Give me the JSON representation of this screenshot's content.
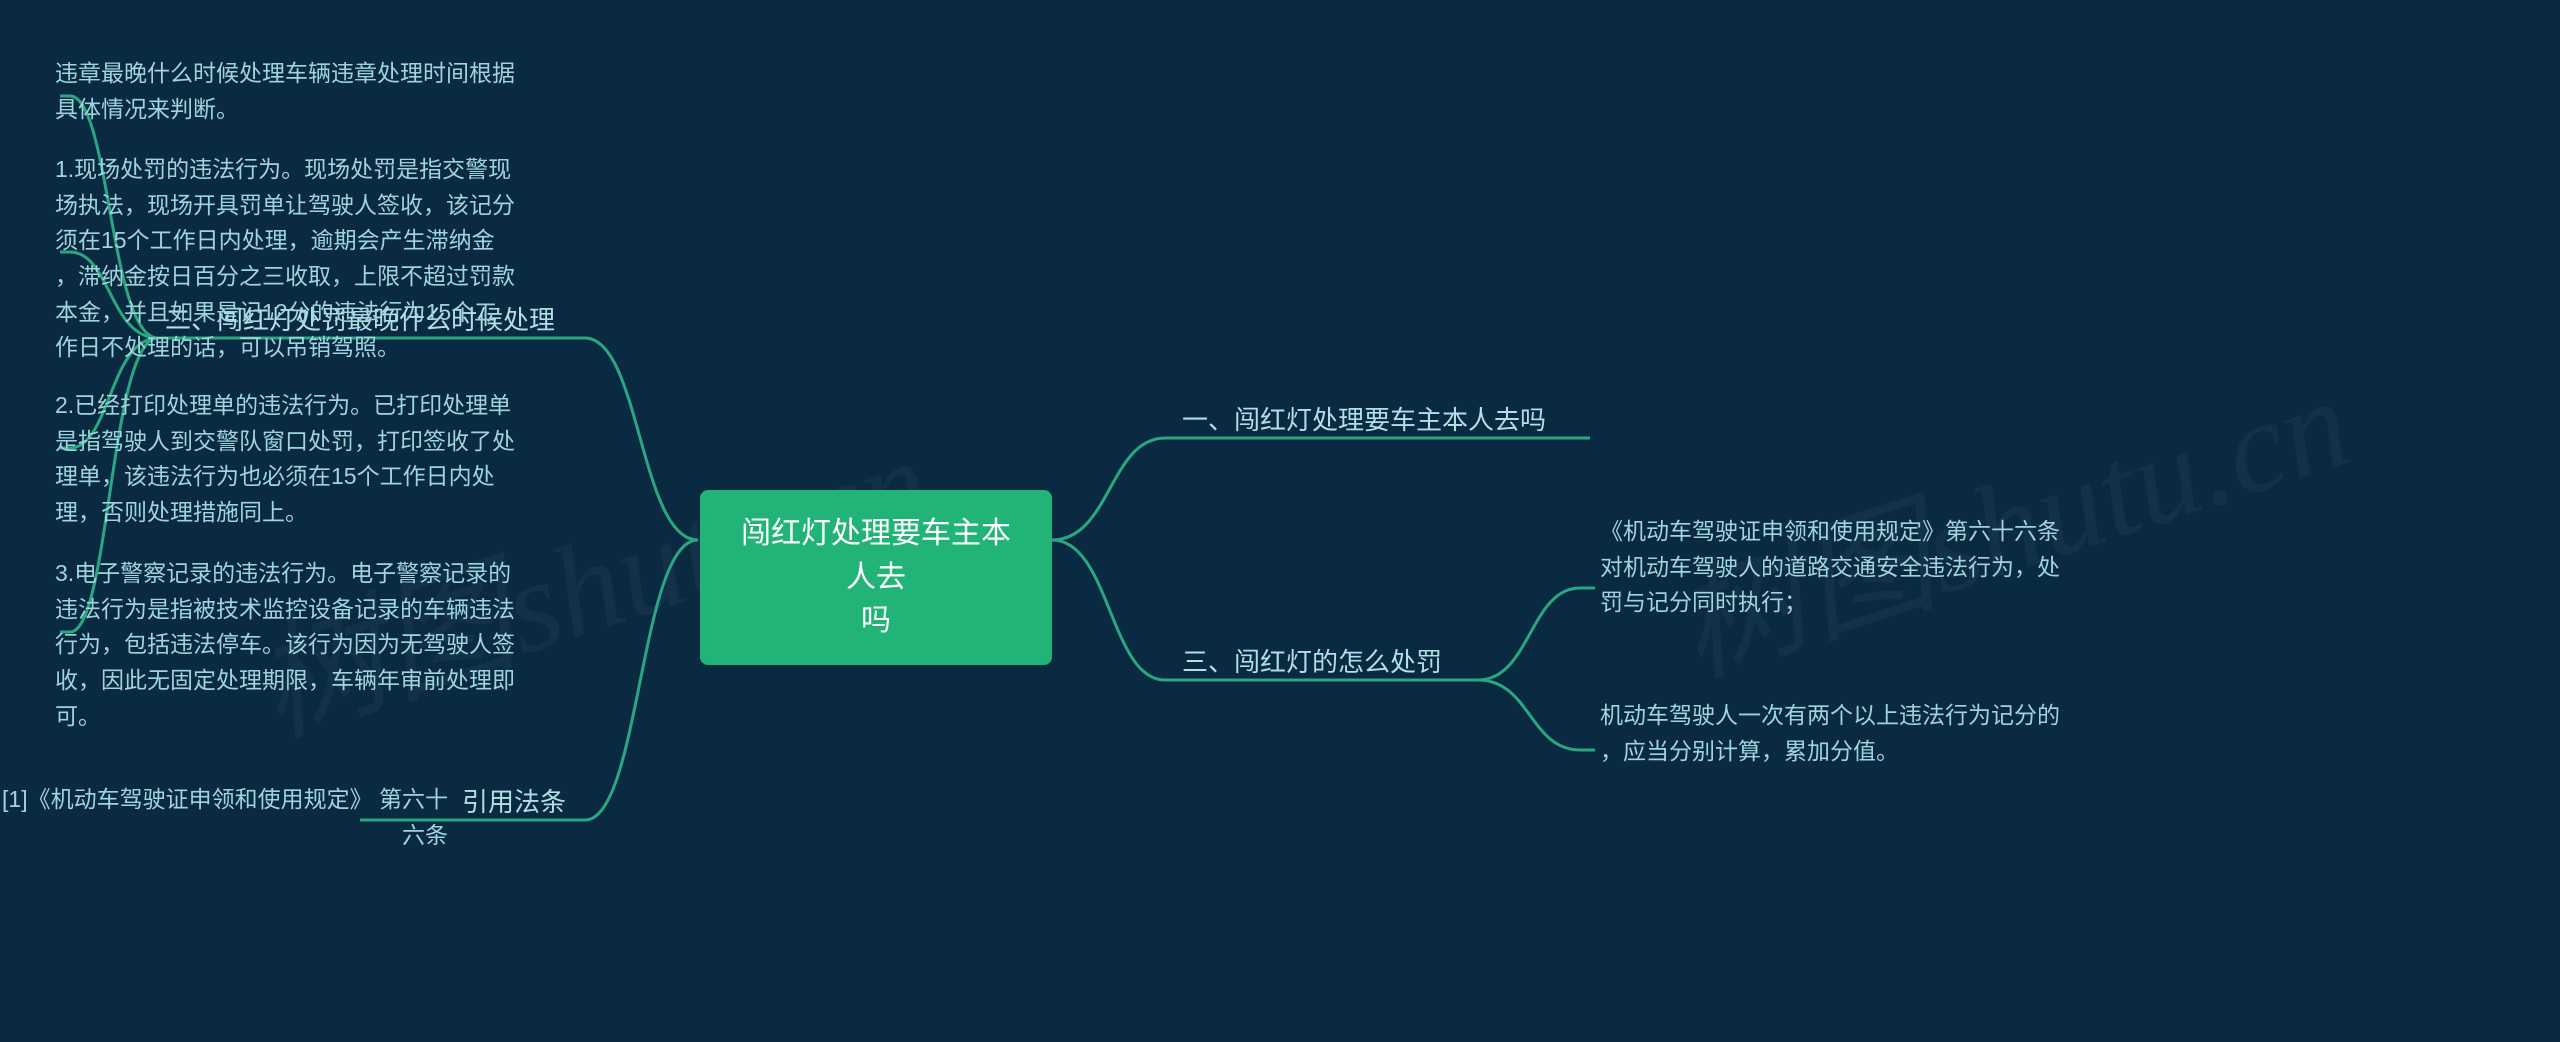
{
  "root": {
    "label": "闯红灯处理要车主本人去\n吗"
  },
  "right": {
    "branch1": {
      "label": "一、闯红灯处理要车主本人去吗"
    },
    "branch3": {
      "label": "三、闯红灯的怎么处罚",
      "leaves": [
        "《机动车驾驶证申领和使用规定》第六十六条\n对机动车驾驶人的道路交通安全违法行为，处\n罚与记分同时执行；",
        "机动车驾驶人一次有两个以上违法行为记分的\n，应当分别计算，累加分值。"
      ]
    }
  },
  "left": {
    "branch2": {
      "label": "二、闯红灯处罚最晚什么时候处理",
      "leaves": [
        "违章最晚什么时候处理车辆违章处理时间根据\n具体情况来判断。",
        "1.现场处罚的违法行为。现场处罚是指交警现\n场执法，现场开具罚单让驾驶人签收，该记分\n须在15个工作日内处理，逾期会产生滞纳金\n，滞纳金按日百分之三收取，上限不超过罚款\n本金，并且如果是记12分的违法行为15个工\n作日不处理的话，可以吊销驾照。",
        "2.已经打印处理单的违法行为。已打印处理单\n是指驾驶人到交警队窗口处罚，打印签收了处\n理单，该违法行为也必须在15个工作日内处\n理，否则处理措施同上。",
        "3.电子警察记录的违法行为。电子警察记录的\n违法行为是指被技术监控设备记录的车辆违法\n行为，包括违法停车。该行为因为无驾驶人签\n收，因此无固定处理期限，车辆年审前处理即\n可。"
      ]
    },
    "branch4": {
      "label": "引用法条",
      "leaf": "[1]《机动车驾驶证申领和使用规定》 第六十\n六条"
    }
  },
  "watermark": "shutu.cn",
  "watermark_cn": "树图"
}
